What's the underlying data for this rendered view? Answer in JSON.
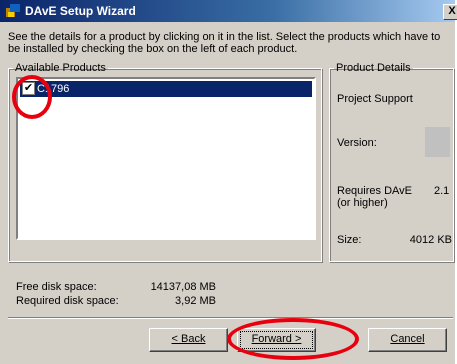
{
  "window": {
    "title": "DAvE Setup Wizard",
    "close_glyph": "X"
  },
  "description": "See the details for a product by clicking on it in the list. Select the products which have to be installed by checking the box on the left of each product.",
  "available_products": {
    "legend": "Available Products",
    "items": [
      {
        "label": "C1796",
        "checked": true,
        "check_glyph": "✔"
      }
    ]
  },
  "product_details": {
    "legend": "Product Details",
    "name": "Project Support",
    "version_label": "Version:",
    "requires_label": "Requires DAvE (or higher)",
    "requires_value": "2.1",
    "size_label": "Size:",
    "size_value": "4012 KB"
  },
  "disk": {
    "free_label": "Free disk space:",
    "free_value": "14137,08 MB",
    "required_label": "Required disk space:",
    "required_value": "3,92 MB"
  },
  "buttons": {
    "back": "< Back",
    "forward": "Forward >",
    "cancel": "Cancel"
  },
  "colors": {
    "titlebar": "#0a246a",
    "selection": "#0a246a",
    "annotation": "#e8000e"
  }
}
